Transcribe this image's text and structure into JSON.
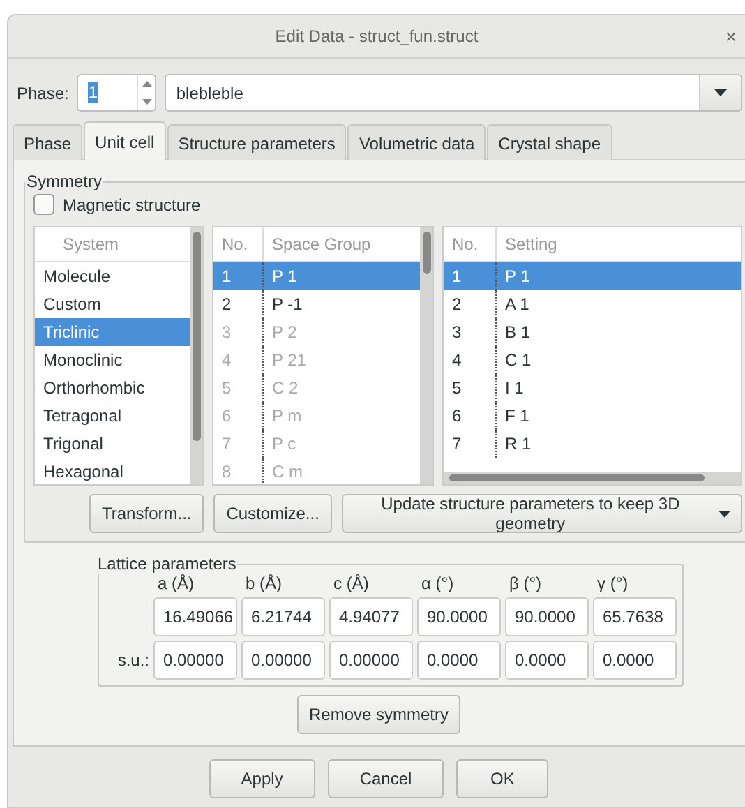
{
  "window": {
    "title": "Edit Data - struct_fun.struct",
    "close": "×"
  },
  "phase": {
    "label": "Phase:",
    "value": "1",
    "value_selected": true,
    "name": "blebleble"
  },
  "tabs": [
    {
      "label": "Phase",
      "selected": false
    },
    {
      "label": "Unit cell",
      "selected": true
    },
    {
      "label": "Structure parameters",
      "selected": false
    },
    {
      "label": "Volumetric data",
      "selected": false
    },
    {
      "label": "Crystal shape",
      "selected": false
    }
  ],
  "symmetry": {
    "title": "Symmetry",
    "magnetic": {
      "label": "Magnetic structure",
      "checked": false
    },
    "system_list": {
      "header": "System",
      "items": [
        {
          "label": "Molecule",
          "selected": false
        },
        {
          "label": "Custom",
          "selected": false
        },
        {
          "label": "Triclinic",
          "selected": true
        },
        {
          "label": "Monoclinic",
          "selected": false
        },
        {
          "label": "Orthorhombic",
          "selected": false
        },
        {
          "label": "Tetragonal",
          "selected": false
        },
        {
          "label": "Trigonal",
          "selected": false
        },
        {
          "label": "Hexagonal",
          "selected": false
        }
      ]
    },
    "space_groups": {
      "columns": [
        "No.",
        "Space Group"
      ],
      "rows": [
        {
          "no": "1",
          "name": "P 1",
          "enabled": true,
          "selected": true
        },
        {
          "no": "2",
          "name": "P -1",
          "enabled": true,
          "selected": false
        },
        {
          "no": "3",
          "name": "P 2",
          "enabled": false,
          "selected": false
        },
        {
          "no": "4",
          "name": "P 21",
          "enabled": false,
          "selected": false
        },
        {
          "no": "5",
          "name": "C 2",
          "enabled": false,
          "selected": false
        },
        {
          "no": "6",
          "name": "P m",
          "enabled": false,
          "selected": false
        },
        {
          "no": "7",
          "name": "P c",
          "enabled": false,
          "selected": false
        },
        {
          "no": "8",
          "name": "C m",
          "enabled": false,
          "selected": false
        }
      ]
    },
    "settings": {
      "columns": [
        "No.",
        "Setting"
      ],
      "rows": [
        {
          "no": "1",
          "name": "P 1",
          "selected": true
        },
        {
          "no": "2",
          "name": "A 1",
          "selected": false
        },
        {
          "no": "3",
          "name": "B 1",
          "selected": false
        },
        {
          "no": "4",
          "name": "C 1",
          "selected": false
        },
        {
          "no": "5",
          "name": "I 1",
          "selected": false
        },
        {
          "no": "6",
          "name": "F 1",
          "selected": false
        },
        {
          "no": "7",
          "name": "R 1",
          "selected": false
        }
      ]
    },
    "buttons": [
      "Transform...",
      "Customize..."
    ],
    "update_menu": "Update structure parameters to keep 3D geometry"
  },
  "lattice": {
    "title": "Lattice parameters",
    "columns": [
      "a (Å)",
      "b (Å)",
      "c (Å)",
      "α (°)",
      "β (°)",
      "γ (°)"
    ],
    "values": [
      "16.49066",
      "6.21744",
      "4.94077",
      "90.0000",
      "90.0000",
      "65.7638"
    ],
    "su_label": "s.u.:",
    "su": [
      "0.00000",
      "0.00000",
      "0.00000",
      "0.0000",
      "0.0000",
      "0.0000"
    ]
  },
  "remove_button": "Remove symmetry",
  "footer_buttons": [
    "Apply",
    "Cancel",
    "OK"
  ]
}
